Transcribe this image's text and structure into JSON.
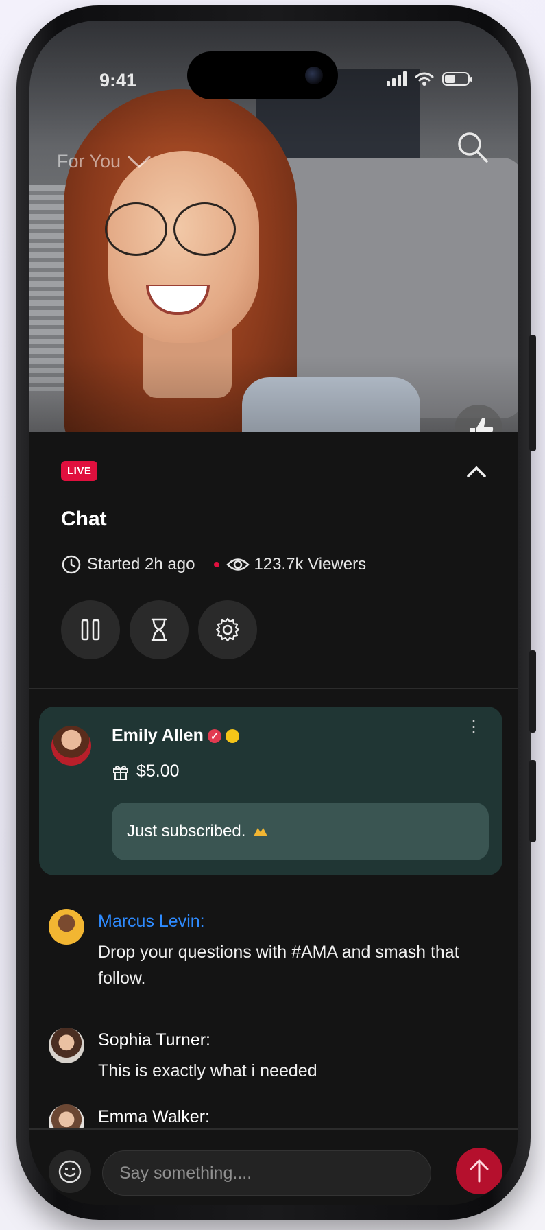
{
  "status_bar": {
    "time": "9:41"
  },
  "top_bar": {
    "feed_label": "For You"
  },
  "stream": {
    "live_label": "LIVE",
    "title": "Chat",
    "started": "Started 2h ago",
    "viewers": "123.7k Viewers"
  },
  "controls": [
    "pause-icon",
    "hourglass-icon",
    "gear-icon"
  ],
  "gift": {
    "name": "Emily Allen",
    "amount": "$5.00",
    "message": "Just subscribed."
  },
  "messages": [
    {
      "name": "Marcus Levin:",
      "text": "Drop your questions with #AMA and smash that follow.",
      "name_color": "#2e8bff"
    },
    {
      "name": "Sophia Turner:",
      "text": "This is exactly what i needed",
      "name_color": "#ffffff"
    },
    {
      "name": "Emma Walker:",
      "text": "",
      "name_color": "#ffffff"
    }
  ],
  "composer": {
    "placeholder": "Say something...."
  },
  "colors": {
    "live": "#e0103e",
    "gift_card": "#203634",
    "send": "#b5102d",
    "mention": "#2e8bff"
  }
}
